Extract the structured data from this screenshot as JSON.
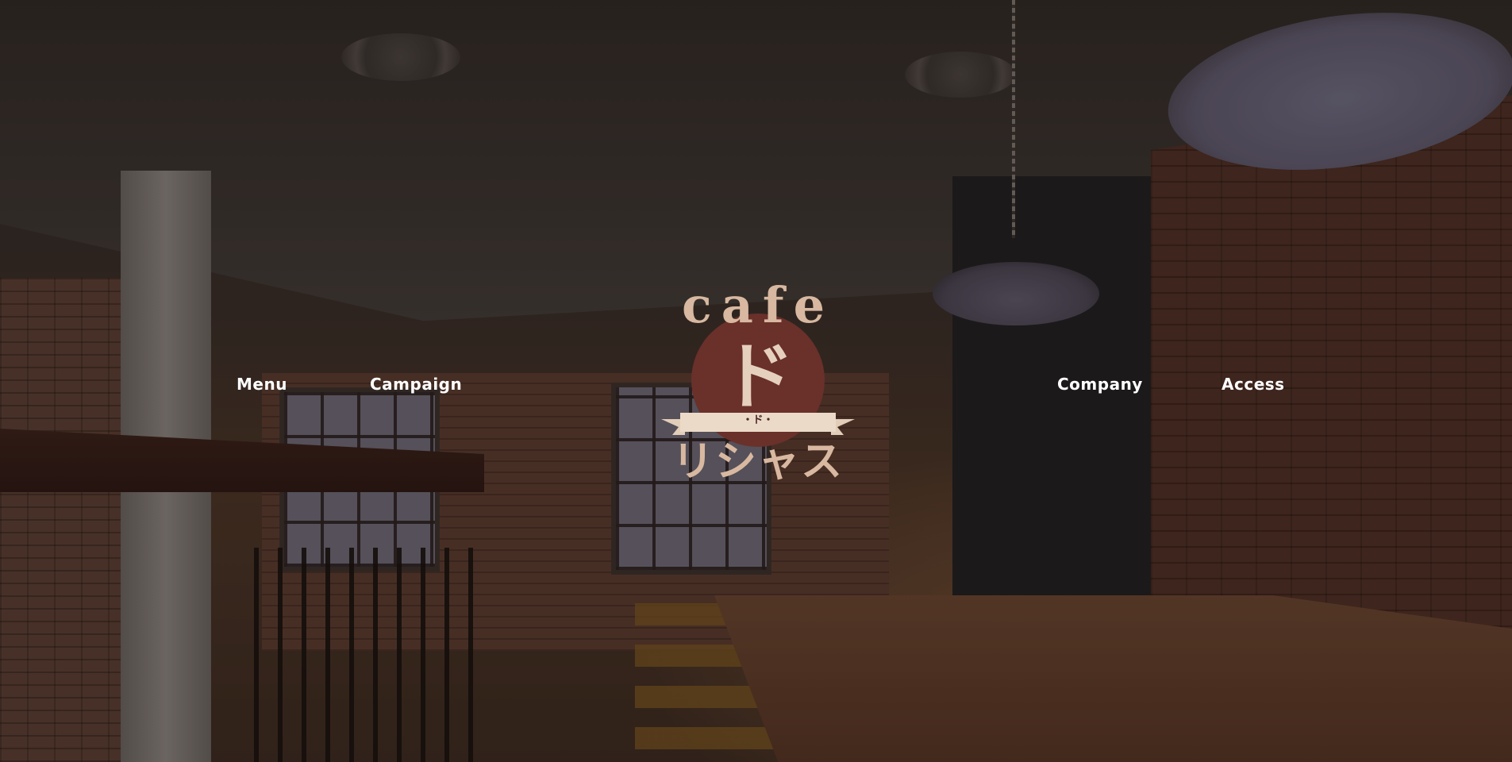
{
  "nav": {
    "left": [
      {
        "label": "Menu"
      },
      {
        "label": "Campaign"
      }
    ],
    "right": [
      {
        "label": "Company"
      },
      {
        "label": "Access"
      }
    ]
  },
  "logo": {
    "cafe": "cafe",
    "do": "ド",
    "ribbon": "・ド・",
    "name": "リシャス"
  },
  "colors": {
    "logo_text": "#d8b8a0",
    "logo_circle": "#6a302a",
    "nav_text": "#ffffff"
  },
  "background": {
    "icon": "cafe-interior-photo"
  }
}
